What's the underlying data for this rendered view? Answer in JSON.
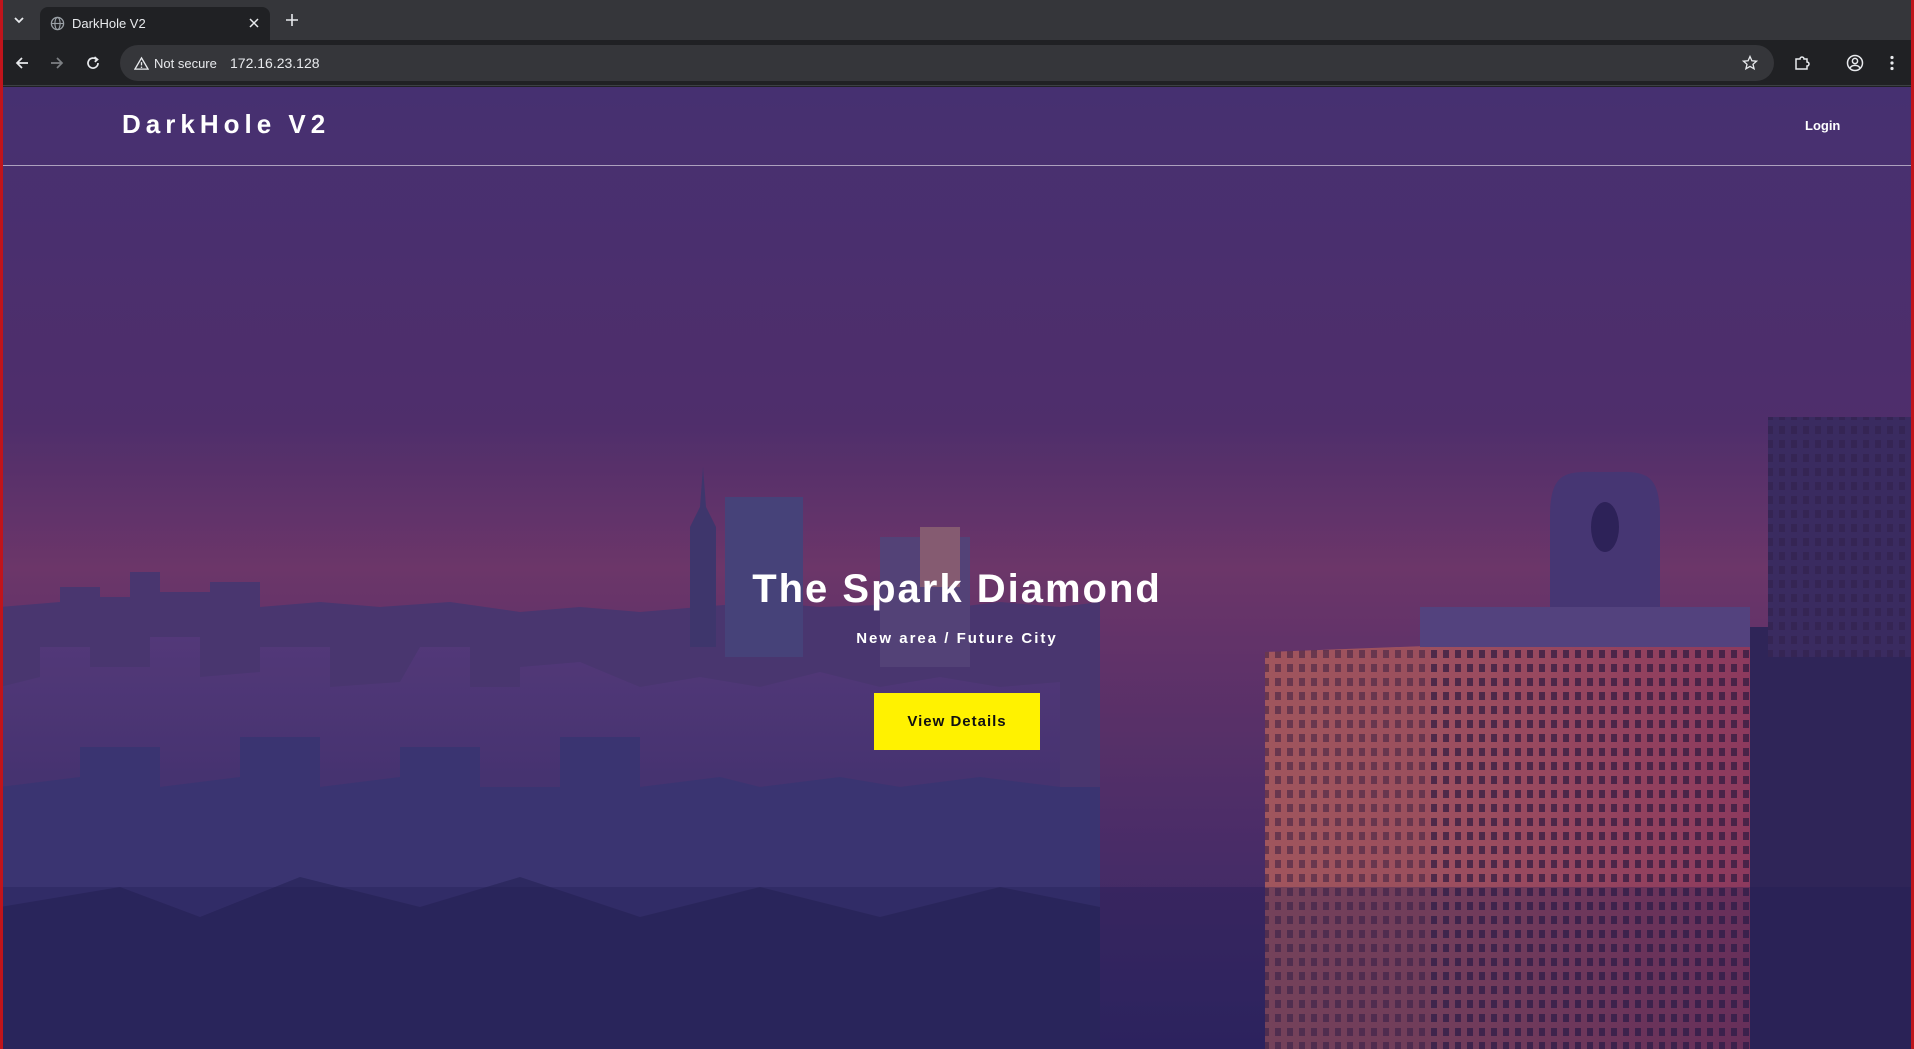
{
  "browser": {
    "tab_title": "DarkHole V2",
    "security_label": "Not secure",
    "url": "172.16.23.128",
    "icons": {
      "tab_list": "chevron-down-icon",
      "favicon": "globe-icon",
      "tab_close": "close-icon",
      "new_tab": "plus-icon",
      "back": "back-arrow-icon",
      "forward": "forward-arrow-icon",
      "reload": "reload-icon",
      "security": "warning-triangle-icon",
      "bookmark": "star-icon",
      "extensions": "puzzle-icon",
      "profile": "profile-icon",
      "menu": "kebab-menu-icon"
    }
  },
  "site": {
    "logo": "DarkHole V2",
    "nav": {
      "login_label": "Login"
    }
  },
  "hero": {
    "title": "The Spark Diamond",
    "subtitle": "New area / Future City",
    "cta_label": "View Details",
    "background": "city skyline at dusk"
  },
  "colors": {
    "overlay_top": "#4a2f6b",
    "overlay_bottom": "#3a2a78",
    "cta_bg": "#fff200",
    "chrome_bg": "#202124",
    "tabstrip_bg": "#35363a"
  }
}
